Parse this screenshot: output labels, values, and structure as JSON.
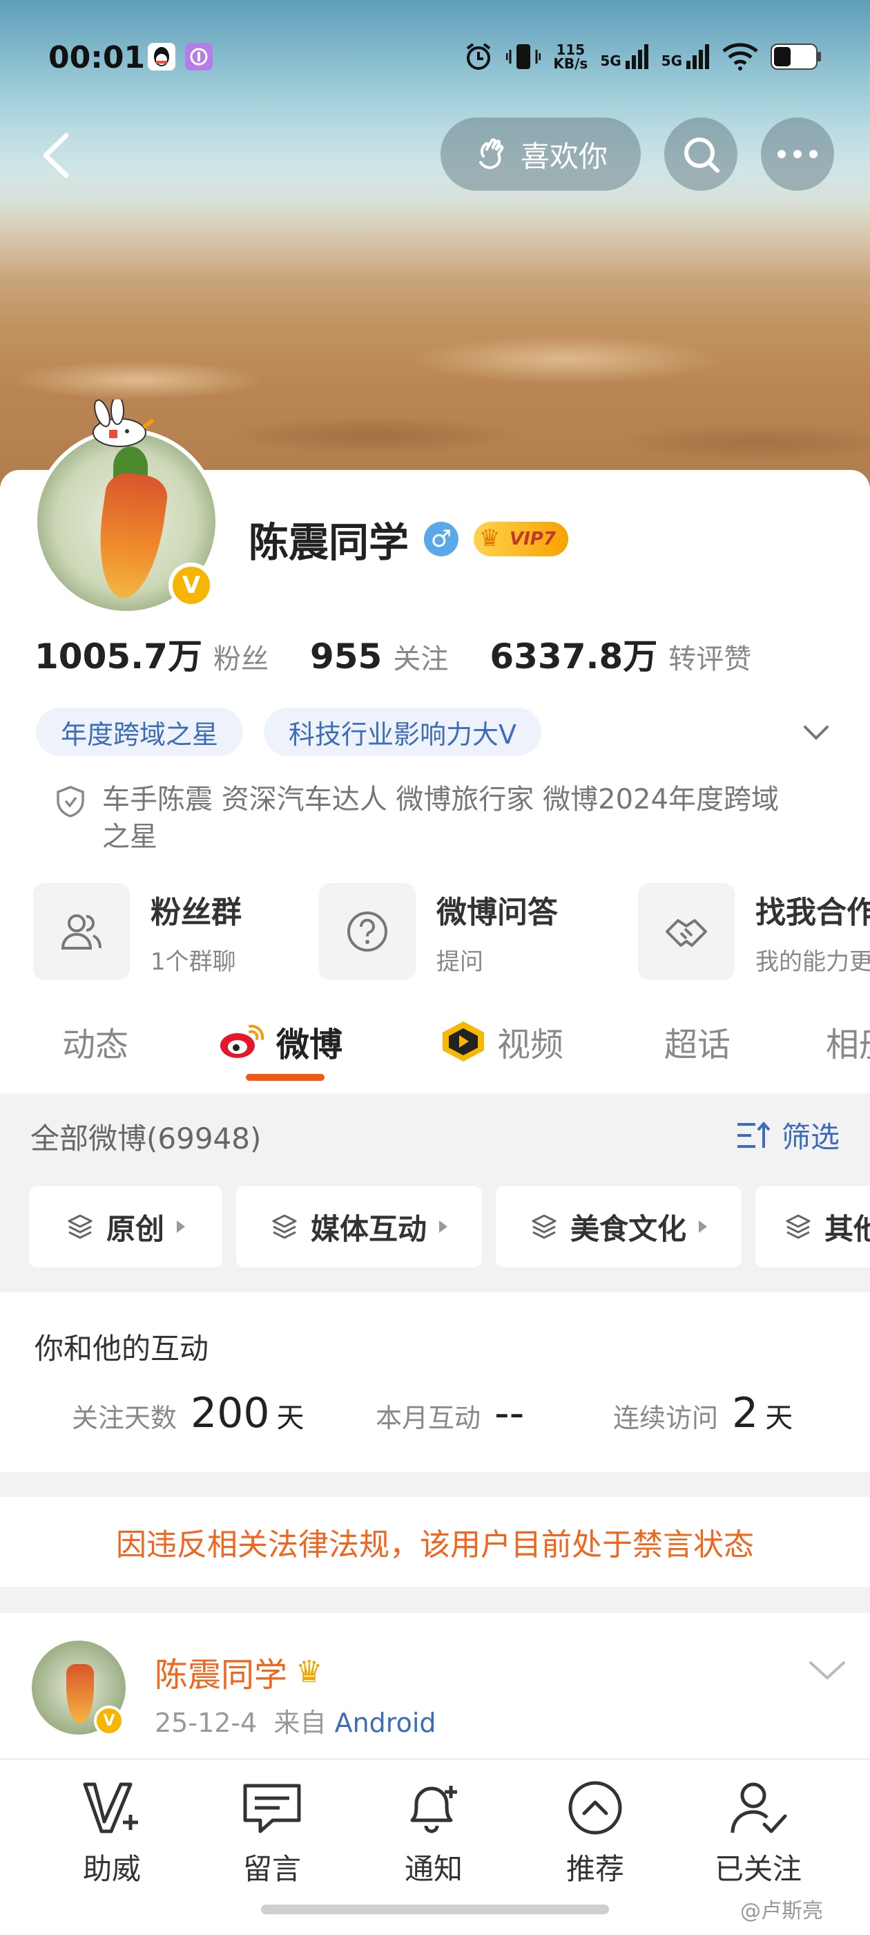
{
  "status_bar": {
    "time": "00:01",
    "net_speed_value": "115",
    "net_speed_unit": "KB/s",
    "signal_1": "5G",
    "signal_2": "5G"
  },
  "top_bar": {
    "like_label": "喜欢你"
  },
  "profile": {
    "name": "陈震同学",
    "vip_label": "VIP7",
    "stats": [
      {
        "value": "1005.7万",
        "label": "粉丝"
      },
      {
        "value": "955",
        "label": "关注"
      },
      {
        "value": "6337.8万",
        "label": "转评赞"
      }
    ],
    "tags": [
      "年度跨域之星",
      "科技行业影响力大V"
    ],
    "bio": "车手陈震 资深汽车达人  微博旅行家 微博2024年度跨域之星"
  },
  "shortcuts": [
    {
      "title": "粉丝群",
      "sub": "1个群聊"
    },
    {
      "title": "微博问答",
      "sub": "提问"
    },
    {
      "title": "找我合作",
      "sub": "我的能力更"
    }
  ],
  "tabs": [
    {
      "label": "动态"
    },
    {
      "label": "微博"
    },
    {
      "label": "视频"
    },
    {
      "label": "超话"
    },
    {
      "label": "相册"
    }
  ],
  "feed": {
    "count_label": "全部微博(69948)",
    "filter_label": "筛选",
    "chips": [
      "原创",
      "媒体互动",
      "美食文化",
      "其他"
    ]
  },
  "interaction": {
    "title": "你和他的互动",
    "follow_days_label": "关注天数",
    "follow_days_value": "200",
    "follow_days_unit": "天",
    "month_label": "本月互动",
    "month_value": "--",
    "visit_label": "连续访问",
    "visit_value": "2",
    "visit_unit": "天"
  },
  "ban_notice": "因违反相关法律法规，该用户目前处于禁言状态",
  "post": {
    "author": "陈震同学",
    "date": "25-12-4",
    "from_label": "来自",
    "source": "Android"
  },
  "bottom_bar": [
    {
      "label": "助威",
      "icon": "cheer-icon"
    },
    {
      "label": "留言",
      "icon": "message-icon"
    },
    {
      "label": "通知",
      "icon": "bell-icon"
    },
    {
      "label": "推荐",
      "icon": "recommend-icon"
    },
    {
      "label": "已关注",
      "icon": "followed-icon"
    }
  ],
  "watermark": "@卢斯亮",
  "colors": {
    "accent_orange": "#f05a16",
    "link_blue": "#3d6cb8",
    "vip_gold": "#f6a300"
  }
}
